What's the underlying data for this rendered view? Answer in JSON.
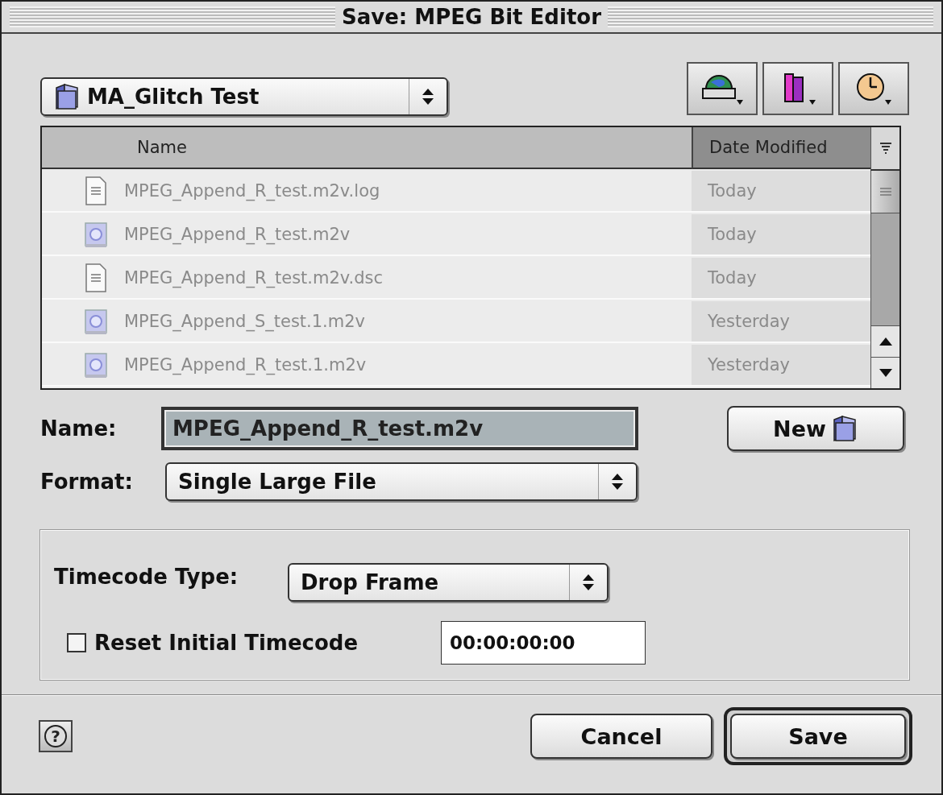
{
  "window": {
    "title": "Save: MPEG Bit Editor"
  },
  "folder_menu": {
    "value": "MA_Glitch Test"
  },
  "file_list": {
    "columns": [
      {
        "label": "Name",
        "selected": false
      },
      {
        "label": "Date Modified",
        "selected": true
      }
    ],
    "rows": [
      {
        "name": "MPEG_Append_R_test.m2v.log",
        "date": "Today",
        "kind": "text"
      },
      {
        "name": "MPEG_Append_R_test.m2v",
        "date": "Today",
        "kind": "movie"
      },
      {
        "name": "MPEG_Append_R_test.m2v.dsc",
        "date": "Today",
        "kind": "text"
      },
      {
        "name": "MPEG_Append_S_test.1.m2v",
        "date": "Yesterday",
        "kind": "movie"
      },
      {
        "name": "MPEG_Append_R_test.1.m2v",
        "date": "Yesterday",
        "kind": "movie"
      }
    ]
  },
  "name_field": {
    "label": "Name:",
    "value": "MPEG_Append_R_test.m2v"
  },
  "new_button": {
    "label": "New"
  },
  "format": {
    "label": "Format:",
    "value": "Single Large File"
  },
  "timecode_type": {
    "label": "Timecode Type:",
    "value": "Drop Frame"
  },
  "reset_timecode": {
    "label": "Reset Initial Timecode",
    "checked": false,
    "value": "00:00:00:00"
  },
  "help_button": {
    "label": "?"
  },
  "buttons": [
    {
      "label": "Cancel",
      "default": false
    },
    {
      "label": "Save",
      "default": true
    }
  ]
}
